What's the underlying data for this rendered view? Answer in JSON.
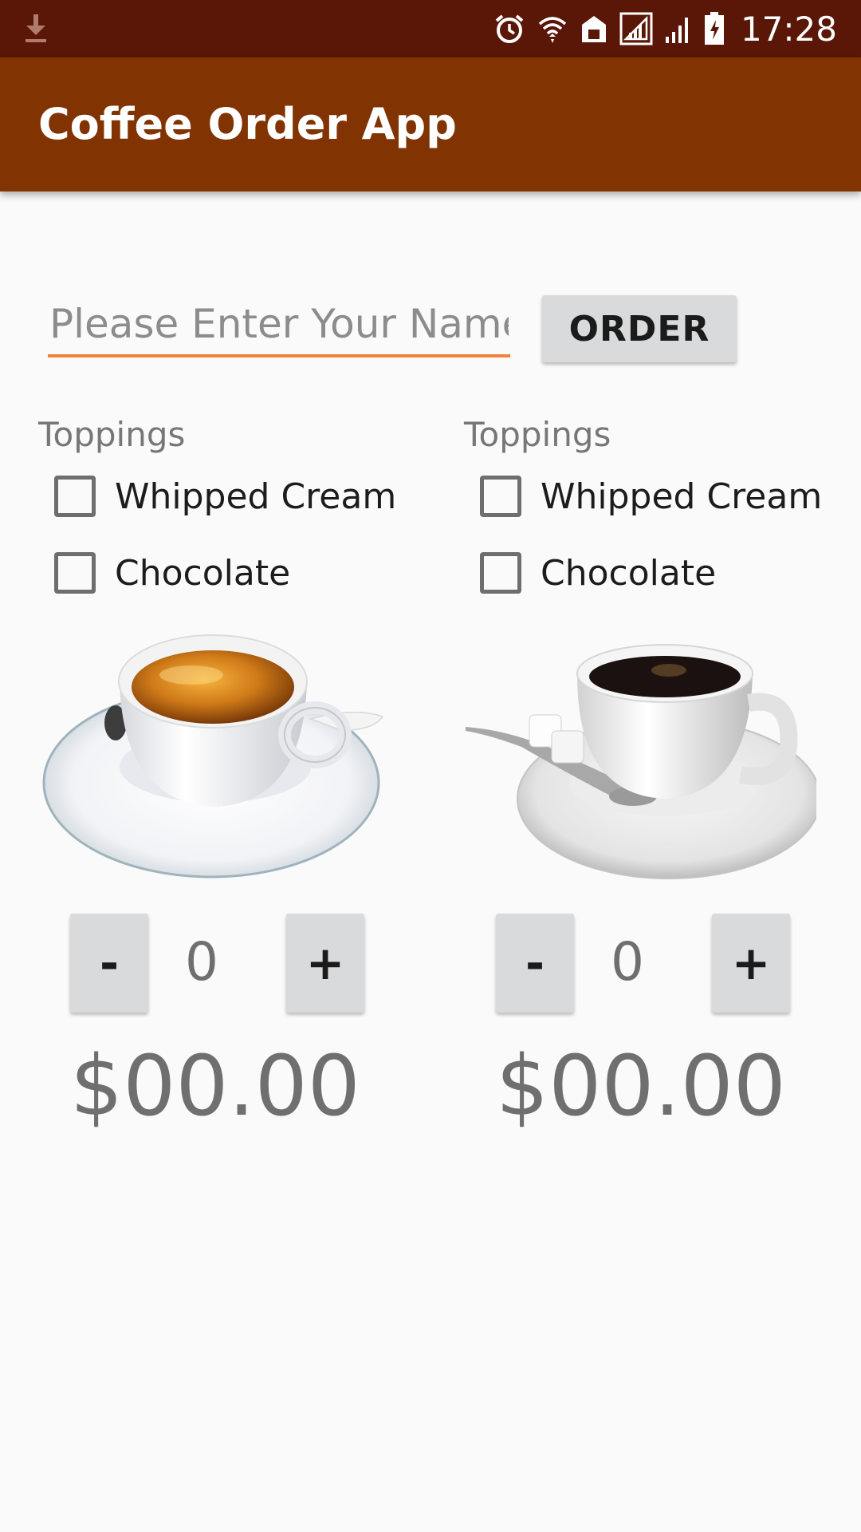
{
  "status_bar": {
    "time": "17:28",
    "icons": [
      "download-icon",
      "alarm-icon",
      "wifi-icon",
      "home-icon",
      "signal-icon",
      "signal-icon",
      "battery-charging-icon"
    ]
  },
  "app_bar": {
    "title": "Coffee Order App"
  },
  "name_field": {
    "placeholder": "Please Enter Your Name",
    "value": ""
  },
  "order_button": {
    "label": "ORDER"
  },
  "columns": [
    {
      "toppings_label": "Toppings",
      "options": [
        {
          "label": "Whipped Cream",
          "checked": false
        },
        {
          "label": "Chocolate",
          "checked": false
        }
      ],
      "image": "espresso-cup-image",
      "minus_label": "-",
      "quantity": "0",
      "plus_label": "+",
      "price": "$00.00"
    },
    {
      "toppings_label": "Toppings",
      "options": [
        {
          "label": "Whipped Cream",
          "checked": false
        },
        {
          "label": "Chocolate",
          "checked": false
        }
      ],
      "image": "black-coffee-cup-image",
      "minus_label": "-",
      "quantity": "0",
      "plus_label": "+",
      "price": "$00.00"
    }
  ],
  "colors": {
    "status_bar": "#5a1707",
    "app_bar": "#813302",
    "accent": "#f2813c",
    "background": "#fafafa"
  }
}
